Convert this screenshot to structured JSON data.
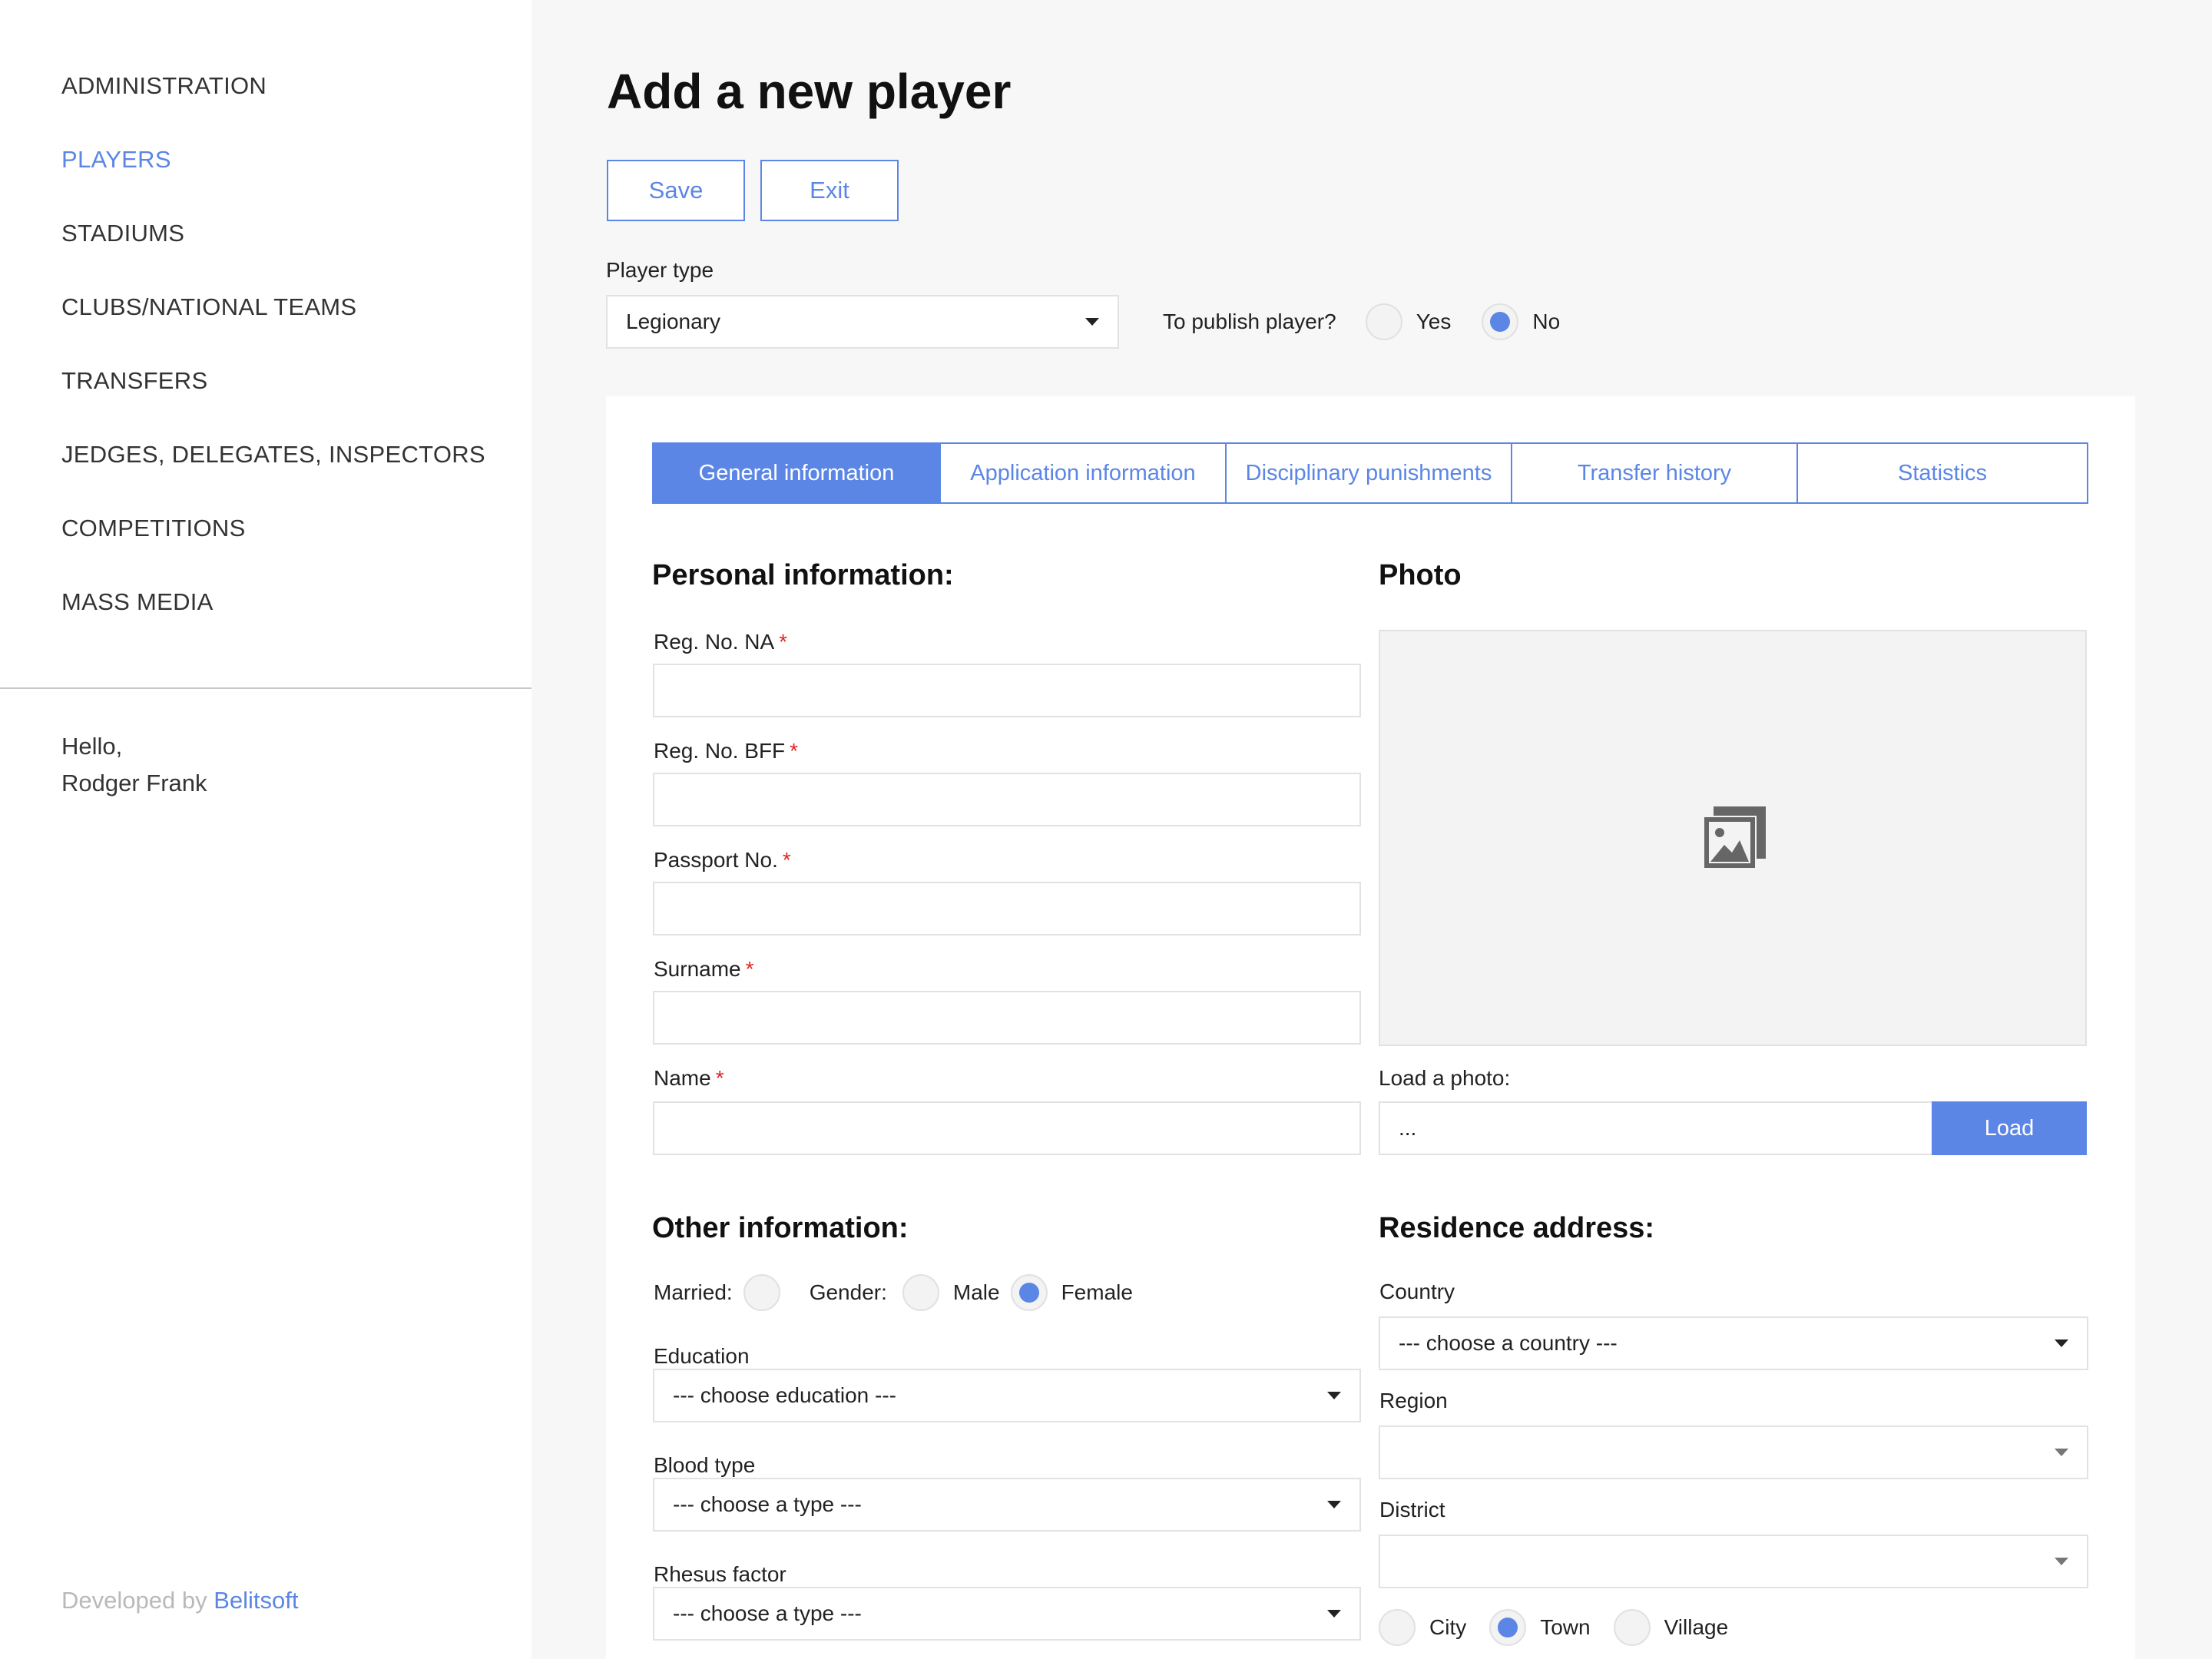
{
  "sidebar": {
    "nav": [
      {
        "label": "ADMINISTRATION"
      },
      {
        "label": "PLAYERS"
      },
      {
        "label": "STADIUMS"
      },
      {
        "label": "CLUBS/NATIONAL TEAMS"
      },
      {
        "label": "TRANSFERS"
      },
      {
        "label": "JEDGES, DELEGATES, INSPECTORS"
      },
      {
        "label": "COMPETITIONS"
      },
      {
        "label": "MASS MEDIA"
      }
    ],
    "active_item": "PLAYERS",
    "greeting_line1": "Hello,",
    "greeting_line2": "Rodger Frank",
    "footer_prefix": "Developed by",
    "footer_link": "Belitsoft"
  },
  "header": {
    "title": "Add a new player",
    "save_label": "Save",
    "exit_label": "Exit"
  },
  "player_type": {
    "label": "Player type",
    "value": "Legionary"
  },
  "publish": {
    "label": "To publish player?",
    "yes_label": "Yes",
    "no_label": "No",
    "selected": "No"
  },
  "tabs": [
    {
      "label": "General information"
    },
    {
      "label": "Application information"
    },
    {
      "label": "Disciplinary punishments"
    },
    {
      "label": "Transfer history"
    },
    {
      "label": "Statistics"
    }
  ],
  "active_tab": "General information",
  "personal": {
    "title": "Personal information:",
    "fields": [
      {
        "label": "Reg. No. NA",
        "required_mark": "*",
        "value": ""
      },
      {
        "label": "Reg. No. BFF",
        "required_mark": "*",
        "value": ""
      },
      {
        "label": "Passport No.",
        "required_mark": "*",
        "value": ""
      },
      {
        "label": "Surname",
        "required_mark": "*",
        "value": ""
      },
      {
        "label": "Name",
        "required_mark": "*",
        "value": ""
      }
    ]
  },
  "photo": {
    "title": "Photo",
    "load_label": "Load a photo:",
    "file_value": "...",
    "load_button": "Load",
    "placeholder_icon": "image-placeholder-icon"
  },
  "other": {
    "title": "Other information:",
    "married_label": "Married:",
    "married_checked": false,
    "gender_label": "Gender:",
    "male_label": "Male",
    "female_label": "Female",
    "gender_selected": "Female",
    "education_label": "Education",
    "education_value": "--- choose education ---",
    "blood_label": "Blood type",
    "blood_value": "--- choose a type ---",
    "rhesus_label": "Rhesus factor",
    "rhesus_value": "--- choose a type ---"
  },
  "residence": {
    "title": "Residence address:",
    "country_label": "Country",
    "country_value": "--- choose a country ---",
    "region_label": "Region",
    "region_value": "",
    "district_label": "District",
    "district_value": "",
    "settlement_options": [
      "City",
      "Town",
      "Village"
    ],
    "settlement_selected": "Town"
  },
  "colors": {
    "accent": "#5b86e5",
    "required": "#e02424",
    "sidebar_bg": "#ffffff",
    "page_bg": "#f7f7f7"
  }
}
